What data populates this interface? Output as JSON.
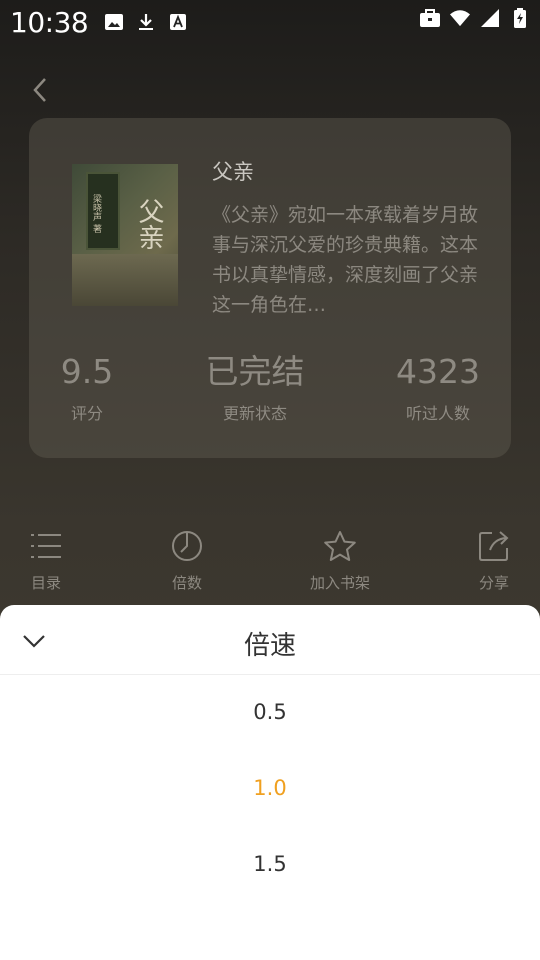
{
  "status_bar": {
    "time": "10:38",
    "left_icons": [
      "image-icon",
      "download-icon",
      "a-box-icon"
    ],
    "right_icons": [
      "briefcase-icon",
      "wifi-icon",
      "signal-icon",
      "battery-icon"
    ]
  },
  "book": {
    "title": "父亲",
    "description": "《父亲》宛如一本承载着岁月故事与深沉父爱的珍贵典籍。这本书以真挚情感，深度刻画了父亲这一角色在…",
    "cover_title": "父亲",
    "cover_subtitle": "梁晓声 著"
  },
  "stats": [
    {
      "value": "9.5",
      "label": "评分"
    },
    {
      "value": "已完结",
      "label": "更新状态"
    },
    {
      "value": "4323",
      "label": "听过人数"
    }
  ],
  "toolbar": [
    {
      "label": "目录",
      "icon": "list-icon"
    },
    {
      "label": "倍数",
      "icon": "timer-icon"
    },
    {
      "label": "加入书架",
      "icon": "star-icon"
    },
    {
      "label": "分享",
      "icon": "share-icon"
    }
  ],
  "speed_sheet": {
    "title": "倍速",
    "options": [
      "0.5",
      "1.0",
      "1.5"
    ],
    "selected": "1.0",
    "selected_color": "#f0a020"
  }
}
